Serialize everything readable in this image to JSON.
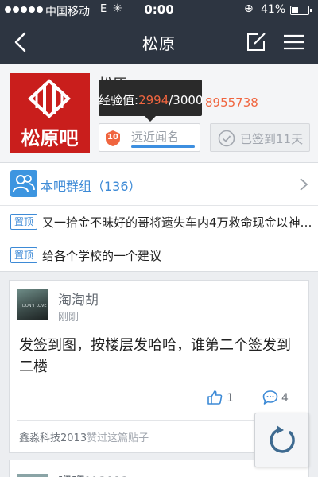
{
  "status_bar": {
    "carrier": "中国移动",
    "network": "E",
    "time": "0:00",
    "battery": "41%",
    "battery_level": 0.41
  },
  "nav": {
    "title": "松原",
    "icons": [
      "back-icon",
      "edit-icon",
      "menu-icon"
    ]
  },
  "forum": {
    "name": "松原",
    "logo_text": "松原吧",
    "member_count": "8955738",
    "exp_label": "经验值:",
    "exp_current": "2994",
    "exp_max": "/3000",
    "level_number": "10",
    "level_name": "远近闻名",
    "level_progress": 0.998,
    "signin_text": "已签到11天"
  },
  "group": {
    "label": "本吧群组（136）"
  },
  "pinned": [
    {
      "badge": "置顶",
      "title": "又一拾金不昧好的哥将遗失车内4万救命现金以神…"
    },
    {
      "badge": "置顶",
      "title": "给各个学校的一个建议"
    }
  ],
  "post": {
    "author": "淘淘胡",
    "time": "刚刚",
    "avatar_text": "DON'T LOVE",
    "body": "发签到图，按楼层发哈哈，谁第二个签发到二楼",
    "likes": "1",
    "comments": "4",
    "liked_by_user": "鑫淼科技2013",
    "liked_by_suffix": "赞过这篇贴子"
  },
  "next_post": {
    "author": "咿咿MOMO"
  },
  "colors": {
    "nav_bg": "#2d3541",
    "accent_blue": "#3d8ad6",
    "accent_orange": "#f0653f",
    "logo_red": "#c91e1c"
  }
}
